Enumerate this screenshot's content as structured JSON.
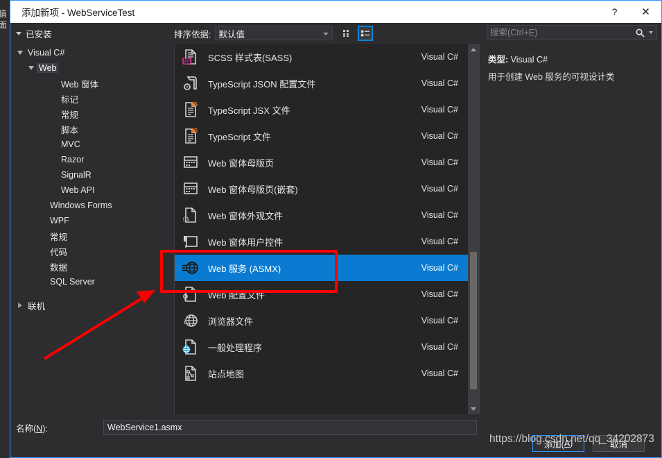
{
  "window": {
    "title": "添加新项 - WebServiceTest",
    "help_label": "?",
    "close_label": "✕"
  },
  "background": {
    "edge_text_1": "值",
    "edge_text_2": "面"
  },
  "toolbar": {
    "installed_label": "已安装",
    "sort_label": "排序依据:",
    "sort_value": "默认值",
    "view_tile_name": "tile-view",
    "view_list_name": "list-view"
  },
  "search": {
    "placeholder": "搜索(Ctrl+E)",
    "value": ""
  },
  "sidebar": {
    "items": [
      {
        "label": "Visual C#",
        "depth": 0,
        "state": "open",
        "selected": false
      },
      {
        "label": "Web",
        "depth": 1,
        "state": "open",
        "selected": true
      },
      {
        "label": "Web 窗体",
        "depth": 3,
        "state": "leaf",
        "selected": false
      },
      {
        "label": "标记",
        "depth": 3,
        "state": "leaf",
        "selected": false
      },
      {
        "label": "常规",
        "depth": 3,
        "state": "leaf",
        "selected": false
      },
      {
        "label": "脚本",
        "depth": 3,
        "state": "leaf",
        "selected": false
      },
      {
        "label": "MVC",
        "depth": 3,
        "state": "leaf",
        "selected": false
      },
      {
        "label": "Razor",
        "depth": 3,
        "state": "leaf",
        "selected": false
      },
      {
        "label": "SignalR",
        "depth": 3,
        "state": "leaf",
        "selected": false
      },
      {
        "label": "Web API",
        "depth": 3,
        "state": "leaf",
        "selected": false
      },
      {
        "label": "Windows Forms",
        "depth": 2,
        "state": "leaf",
        "selected": false
      },
      {
        "label": "WPF",
        "depth": 2,
        "state": "leaf",
        "selected": false
      },
      {
        "label": "常规",
        "depth": 2,
        "state": "leaf",
        "selected": false
      },
      {
        "label": "代码",
        "depth": 2,
        "state": "leaf",
        "selected": false
      },
      {
        "label": "数据",
        "depth": 2,
        "state": "leaf",
        "selected": false
      },
      {
        "label": "SQL Server",
        "depth": 2,
        "state": "leaf",
        "selected": false
      },
      {
        "label": "",
        "depth": 0,
        "state": "spacer",
        "selected": false
      },
      {
        "label": "联机",
        "depth": 0,
        "state": "closed",
        "selected": false
      }
    ]
  },
  "list": {
    "items": [
      {
        "name": "SCSS 样式表(SASS)",
        "type": "Visual C#",
        "icon": "scss-file-icon",
        "selected": false
      },
      {
        "name": "TypeScript JSON 配置文件",
        "type": "Visual C#",
        "icon": "tsconfig-json-icon",
        "selected": false
      },
      {
        "name": "TypeScript JSX 文件",
        "type": "Visual C#",
        "icon": "typescript-jsx-icon",
        "selected": false
      },
      {
        "name": "TypeScript 文件",
        "type": "Visual C#",
        "icon": "typescript-file-icon",
        "selected": false
      },
      {
        "name": "Web 窗体母版页",
        "type": "Visual C#",
        "icon": "master-page-icon",
        "selected": false
      },
      {
        "name": "Web 窗体母版页(嵌套)",
        "type": "Visual C#",
        "icon": "nested-master-page-icon",
        "selected": false
      },
      {
        "name": "Web 窗体外观文件",
        "type": "Visual C#",
        "icon": "skin-file-icon",
        "selected": false
      },
      {
        "name": "Web 窗体用户控件",
        "type": "Visual C#",
        "icon": "user-control-icon",
        "selected": false
      },
      {
        "name": "Web 服务 (ASMX)",
        "type": "Visual C#",
        "icon": "web-service-icon",
        "selected": true
      },
      {
        "name": "Web 配置文件",
        "type": "Visual C#",
        "icon": "web-config-icon",
        "selected": false
      },
      {
        "name": "浏览器文件",
        "type": "Visual C#",
        "icon": "browser-file-icon",
        "selected": false
      },
      {
        "name": "一般处理程序",
        "type": "Visual C#",
        "icon": "generic-handler-icon",
        "selected": false
      },
      {
        "name": "站点地图",
        "type": "Visual C#",
        "icon": "sitemap-icon",
        "selected": false
      }
    ]
  },
  "details": {
    "type_label": "类型:",
    "type_value": "Visual C#",
    "description": "用于创建 Web 服务的可视设计类"
  },
  "footer": {
    "name_label_prefix": "名称(",
    "name_label_key": "N",
    "name_label_suffix": "):",
    "name_value": "WebService1.asmx",
    "add_prefix": "添加(",
    "add_key": "A",
    "add_suffix": ")",
    "cancel_label": "取消"
  },
  "annotations": {
    "watermark": "https://blog.csdn.net/qq_34202873",
    "highlight_color": "#ff0000",
    "selection_color": "#0a7bd0"
  }
}
